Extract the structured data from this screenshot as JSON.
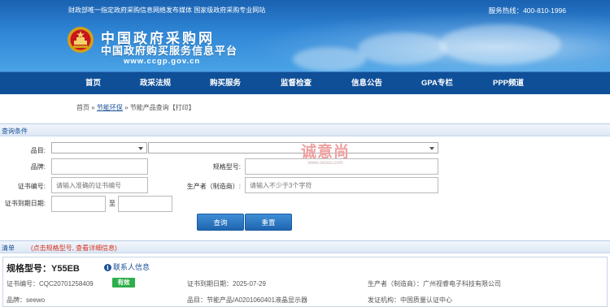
{
  "header": {
    "slogan": "财政部唯一指定政府采购信息网络发布媒体  国家级政府采购专业网站",
    "hotline": "服务热线：400-810-1996",
    "site_name": "中国政府采购网",
    "site_subtitle": "中国政府购买服务信息平台",
    "url": "www.ccgp.gov.cn"
  },
  "nav": [
    "首页",
    "政采法规",
    "购买服务",
    "监督检查",
    "信息公告",
    "GPA专栏",
    "PPP频道"
  ],
  "breadcrumb": {
    "home": "首页",
    "sep1": " » ",
    "eco": "节能环保",
    "sep2": " » ",
    "current": "节能产品查询",
    "print": "【打印】"
  },
  "query": {
    "title": "查询条件",
    "category_label": "品目:",
    "brand_label": "品牌:",
    "model_label": "规格型号:",
    "cert_no_label": "证书编号:",
    "cert_no_placeholder": "请输入准确的证书编号",
    "producer_label": "生产者（制造商）:",
    "producer_placeholder": "请输入不少于3个字符",
    "expiry_label": "证书到期日期:",
    "to_label": "至",
    "search_button": "查询",
    "reset_button": "重置"
  },
  "watermark": {
    "text": "诚意尚",
    "url": "www.cesou.com"
  },
  "list": {
    "title": "清单",
    "hint": "(点击规格型号, 查看详细信息)"
  },
  "result": {
    "model": "规格型号：Y55EB",
    "contact": "联系人信息",
    "cert_no": "证书编号：CQC20701258409",
    "status": "有效",
    "status_color": "#2fae4c",
    "expiry": "证书到期日期：2025-07-29",
    "producer": "生产者（制造商）：广州视睿电子科技有限公司",
    "brand": "品牌：seewo",
    "category": "品目：节能产品/A0201060401液晶显示器",
    "issuer": "发证机构：中国质量认证中心"
  }
}
